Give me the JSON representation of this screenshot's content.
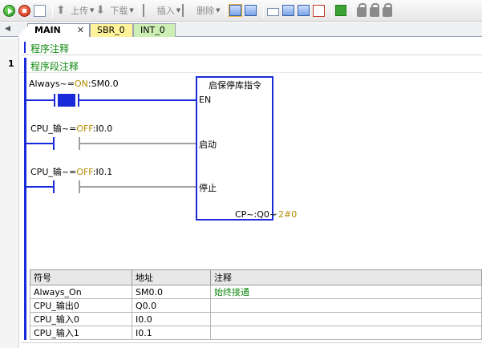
{
  "toolbar": {
    "upload_label": "上传",
    "download_label": "下载",
    "insert_label": "插入",
    "delete_label": "删除"
  },
  "tabs": [
    {
      "label": "MAIN",
      "active": true
    },
    {
      "label": "SBR_0",
      "color": "#fef39a"
    },
    {
      "label": "INT_0",
      "color": "#cdefb5"
    }
  ],
  "editor": {
    "program_comment": "程序注释",
    "rung_number": "1",
    "rung_comment": "程序段注释"
  },
  "rung": {
    "contacts": [
      {
        "symbol": "Always~",
        "eq": "=",
        "state": "ON",
        "address": "SM0.0",
        "energized": true
      },
      {
        "symbol": "CPU_输~",
        "eq": "=",
        "state": "OFF",
        "address": "I0.0",
        "energized": false
      },
      {
        "symbol": "CPU_输~",
        "eq": "=",
        "state": "OFF",
        "address": "I0.1",
        "energized": false
      }
    ],
    "function_block": {
      "title": "启保停库指令",
      "pins": [
        "EN",
        "启动",
        "停止"
      ],
      "output_label": "CP~:Q0~",
      "output_value": "2#0"
    }
  },
  "symbol_table": {
    "headers": [
      "符号",
      "地址",
      "注释"
    ],
    "rows": [
      [
        "Always_On",
        "SM0.0",
        "始终接通"
      ],
      [
        "CPU_输出0",
        "Q0.0",
        ""
      ],
      [
        "CPU_输入0",
        "I0.0",
        ""
      ],
      [
        "CPU_输入1",
        "I0.1",
        ""
      ]
    ]
  },
  "colors": {
    "power_flow": "#1a2ad8",
    "inactive": "#a0a0a0",
    "comment_green": "#128a12",
    "state_value": "#b38b00"
  }
}
